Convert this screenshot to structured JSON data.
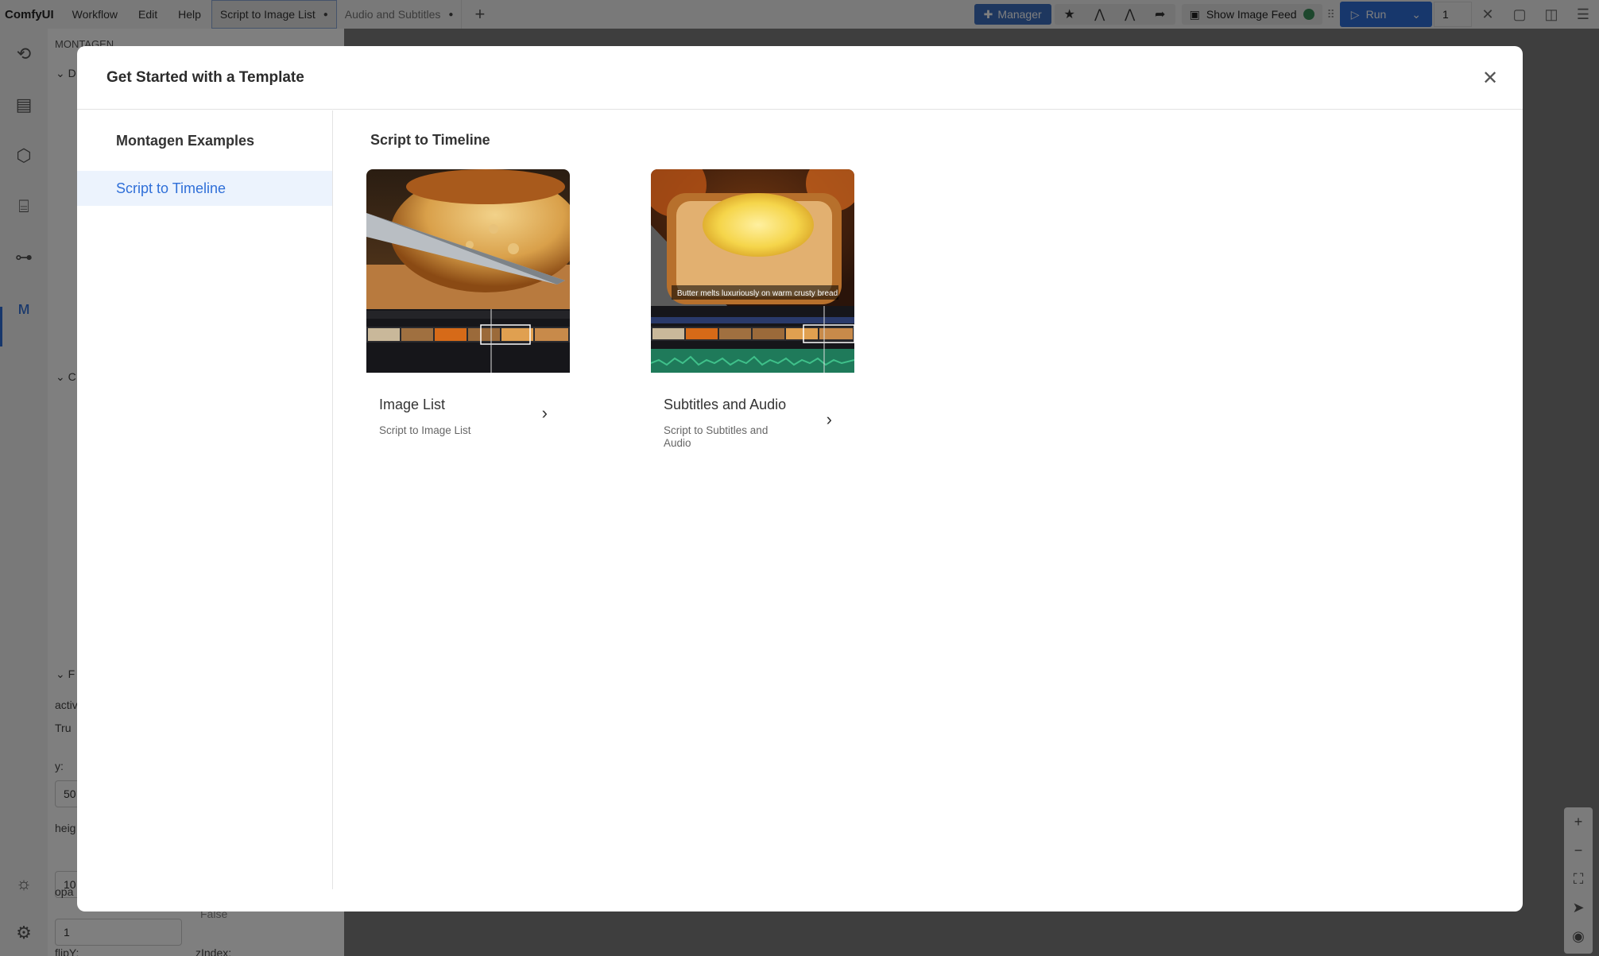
{
  "topbar": {
    "logo": "ComfyUI",
    "menu": [
      "Workflow",
      "Edit",
      "Help"
    ],
    "tabs": [
      {
        "label": "Script to Image List",
        "active": true
      },
      {
        "label": "Audio and Subtitles",
        "active": false
      }
    ],
    "manager_label": "Manager",
    "image_feed_label": "Show Image Feed",
    "run_label": "Run",
    "queue_count": "1"
  },
  "sidebar": {
    "title": "MONTAGEN",
    "fields": {
      "active_label": "activ",
      "active_value": "Tru",
      "y_label": "y:",
      "y_value": "50",
      "height_label": "heig",
      "height_value": "10",
      "opacity_label": "opa",
      "opacity_value": "1",
      "false_label": "False",
      "flipy_label": "flipY:",
      "zindex_label": "zIndex:"
    },
    "letters": [
      "D",
      "C",
      "F"
    ]
  },
  "modal": {
    "title": "Get Started with a Template",
    "side_heading": "Montagen Examples",
    "side_items": [
      {
        "label": "Script to Timeline",
        "selected": true
      }
    ],
    "section_title": "Script to Timeline",
    "cards": [
      {
        "name": "Image List",
        "description": "Script to Image List"
      },
      {
        "name": "Subtitles and Audio",
        "description": "Script to Subtitles and Audio",
        "caption": "Butter melts luxuriously on warm crusty bread"
      }
    ]
  },
  "colors": {
    "accent": "#2f6fd8",
    "manager": "#3c6fbf",
    "selected_bg": "#ecf3fd"
  }
}
